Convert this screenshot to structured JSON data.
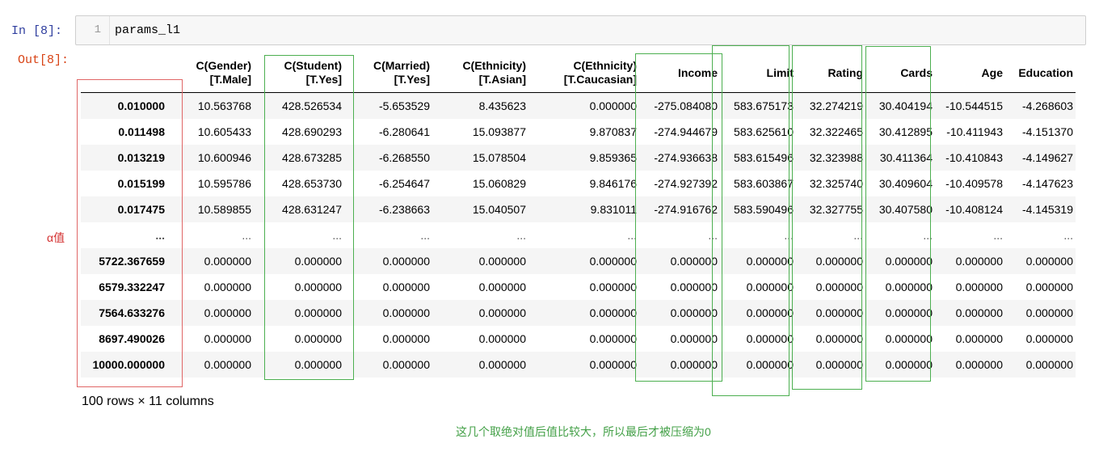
{
  "cell": {
    "in_prompt": "In  [8]:",
    "out_prompt": "Out[8]:",
    "line_number": "1",
    "code": "params_l1"
  },
  "table": {
    "columns": [
      [
        "C(Gender)",
        "[T.Male]"
      ],
      [
        "C(Student)",
        "[T.Yes]"
      ],
      [
        "C(Married)",
        "[T.Yes]"
      ],
      [
        "C(Ethnicity)",
        "[T.Asian]"
      ],
      [
        "C(Ethnicity)",
        "[T.Caucasian]"
      ],
      [
        "Income",
        ""
      ],
      [
        "Limit",
        ""
      ],
      [
        "Rating",
        ""
      ],
      [
        "Cards",
        ""
      ],
      [
        "Age",
        ""
      ],
      [
        "Education",
        ""
      ]
    ],
    "rows": [
      {
        "index": "0.010000",
        "values": [
          "10.563768",
          "428.526534",
          "-5.653529",
          "8.435623",
          "0.000000",
          "-275.084080",
          "583.675173",
          "32.274219",
          "30.404194",
          "-10.544515",
          "-4.268603"
        ]
      },
      {
        "index": "0.011498",
        "values": [
          "10.605433",
          "428.690293",
          "-6.280641",
          "15.093877",
          "9.870837",
          "-274.944679",
          "583.625610",
          "32.322465",
          "30.412895",
          "-10.411943",
          "-4.151370"
        ]
      },
      {
        "index": "0.013219",
        "values": [
          "10.600946",
          "428.673285",
          "-6.268550",
          "15.078504",
          "9.859365",
          "-274.936638",
          "583.615496",
          "32.323988",
          "30.411364",
          "-10.410843",
          "-4.149627"
        ]
      },
      {
        "index": "0.015199",
        "values": [
          "10.595786",
          "428.653730",
          "-6.254647",
          "15.060829",
          "9.846176",
          "-274.927392",
          "583.603867",
          "32.325740",
          "30.409604",
          "-10.409578",
          "-4.147623"
        ]
      },
      {
        "index": "0.017475",
        "values": [
          "10.589855",
          "428.631247",
          "-6.238663",
          "15.040507",
          "9.831011",
          "-274.916762",
          "583.590496",
          "32.327755",
          "30.407580",
          "-10.408124",
          "-4.145319"
        ]
      },
      {
        "index": "...",
        "values": [
          "...",
          "...",
          "...",
          "...",
          "...",
          "...",
          "...",
          "...",
          "...",
          "...",
          "..."
        ]
      },
      {
        "index": "5722.367659",
        "values": [
          "0.000000",
          "0.000000",
          "0.000000",
          "0.000000",
          "0.000000",
          "0.000000",
          "0.000000",
          "0.000000",
          "0.000000",
          "0.000000",
          "0.000000"
        ]
      },
      {
        "index": "6579.332247",
        "values": [
          "0.000000",
          "0.000000",
          "0.000000",
          "0.000000",
          "0.000000",
          "0.000000",
          "0.000000",
          "0.000000",
          "0.000000",
          "0.000000",
          "0.000000"
        ]
      },
      {
        "index": "7564.633276",
        "values": [
          "0.000000",
          "0.000000",
          "0.000000",
          "0.000000",
          "0.000000",
          "0.000000",
          "0.000000",
          "0.000000",
          "0.000000",
          "0.000000",
          "0.000000"
        ]
      },
      {
        "index": "8697.490026",
        "values": [
          "0.000000",
          "0.000000",
          "0.000000",
          "0.000000",
          "0.000000",
          "0.000000",
          "0.000000",
          "0.000000",
          "0.000000",
          "0.000000",
          "0.000000"
        ]
      },
      {
        "index": "10000.000000",
        "values": [
          "0.000000",
          "0.000000",
          "0.000000",
          "0.000000",
          "0.000000",
          "0.000000",
          "0.000000",
          "0.000000",
          "0.000000",
          "0.000000",
          "0.000000"
        ]
      }
    ],
    "summary": "100 rows × 11 columns"
  },
  "annotations": {
    "alpha_label": "α值",
    "note": "这几个取绝对值后值比较大，所以最后才被压缩为0",
    "red_color": "#e06666",
    "green_color": "#4caf50"
  }
}
